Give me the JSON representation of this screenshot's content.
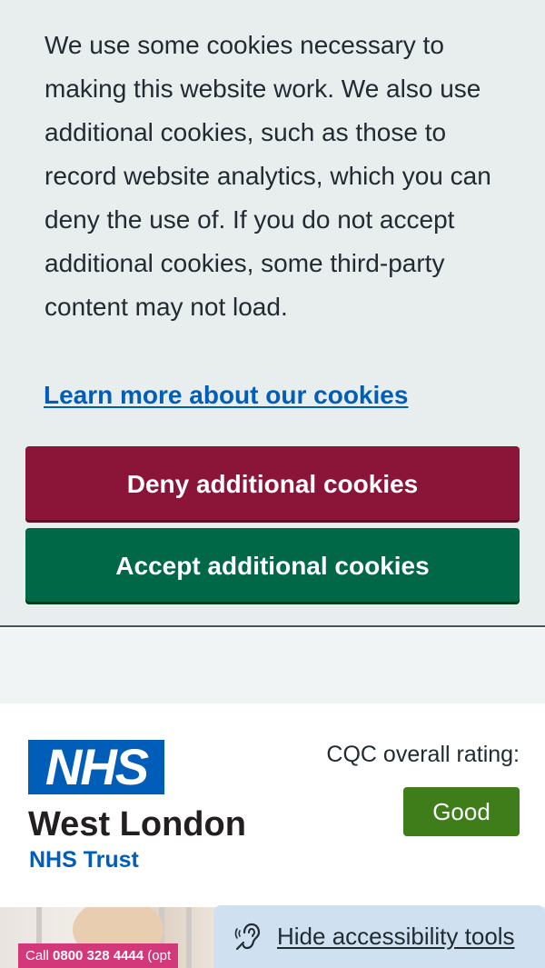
{
  "cookie_banner": {
    "message": "We use some cookies necessary to making this website work. We also use additional cookies, such as those to record website analytics, which you can deny the use of. If you do not accept additional cookies, some third-party content may not load.",
    "learn_more_link": "Learn more about our cookies",
    "deny_button": "Deny additional cookies",
    "accept_button": "Accept additional cookies",
    "colors": {
      "background": "#e8edee",
      "deny": "#8a1538",
      "accept": "#006747",
      "link": "#005eb8"
    }
  },
  "header": {
    "logo_text": "NHS",
    "org_name": "West London",
    "org_subtitle": "NHS Trust",
    "cqc_label": "CQC overall rating:",
    "cqc_rating": "Good",
    "colors": {
      "nhs_blue": "#005eb8",
      "rating_green": "#3f7d1b"
    }
  },
  "hero": {
    "call_prefix": "Call ",
    "call_number": "0800 328 4444",
    "call_suffix": " (opt"
  },
  "accessibility": {
    "icon": "ear-icon",
    "label": "Hide accessibility tools"
  }
}
